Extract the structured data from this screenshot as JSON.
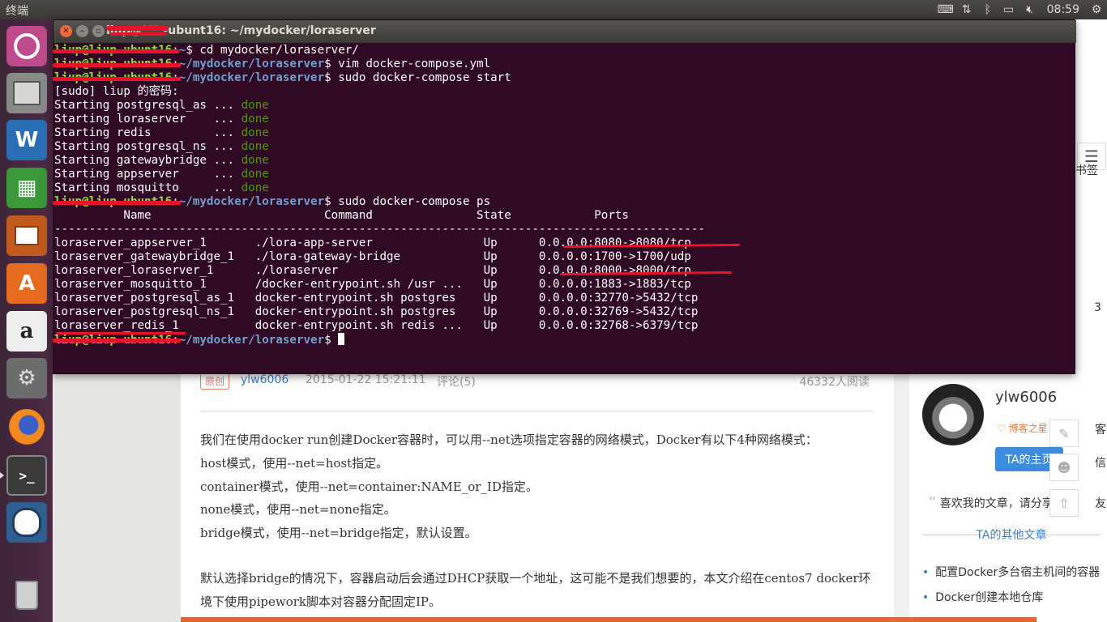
{
  "top_panel": {
    "app_title": "终端",
    "clock": "08:59",
    "tray": [
      "keyboard-icon",
      "network-icon",
      "bluetooth-icon",
      "battery-icon",
      "volume-muted-icon",
      "power-gear-icon"
    ]
  },
  "launcher": {
    "items": [
      "ubuntu-dash-icon",
      "files-icon",
      "libreoffice-writer-icon",
      "libreoffice-calc-icon",
      "libreoffice-impress-icon",
      "software-center-icon",
      "amazon-icon",
      "system-settings-icon",
      "firefox-icon",
      "terminal-icon",
      "postgresql-icon",
      "trash-icon"
    ],
    "amazon_glyph": "a",
    "software_glyph": "A",
    "writer_glyph": "W",
    "calc_glyph": "▦",
    "terminal_glyph": ">_"
  },
  "terminal": {
    "title": "liup@*** -ubunt16: ~/mydocker/loraserver",
    "prompt_dir": "~/mydocker/loraserver",
    "lines": [
      {
        "prompt_host": "liup@liup-ubunt16",
        "sep": ":",
        "dir": "~",
        "cmd": "$ cd mydocker/loraserver/"
      },
      {
        "prompt_host": "liup@liup-ubunt16",
        "sep": ":",
        "dir": "~/mydocker/loraserver",
        "cmd": "$ vim docker-compose.yml"
      },
      {
        "prompt_host": "liup@liup-ubunt16",
        "sep": ":",
        "dir": "~/mydocker/loraserver",
        "cmd": "$ sudo docker-compose start"
      },
      {
        "text": "[sudo] liup 的密码:"
      },
      {
        "text": "Starting postgresql_as ... ",
        "status": "done"
      },
      {
        "text": "Starting loraserver    ... ",
        "status": "done"
      },
      {
        "text": "Starting redis         ... ",
        "status": "done"
      },
      {
        "text": "Starting postgresql_ns ... ",
        "status": "done"
      },
      {
        "text": "Starting gatewaybridge ... ",
        "status": "done"
      },
      {
        "text": "Starting appserver     ... ",
        "status": "done"
      },
      {
        "text": "Starting mosquitto     ... ",
        "status": "done"
      },
      {
        "prompt_host": "liup@liup-ubunt16",
        "sep": ":",
        "dir": "~/mydocker/loraserver",
        "cmd": "$ sudo docker-compose ps"
      },
      {
        "text": "          Name                         Command               State            Ports          "
      },
      {
        "text": "----------------------------------------------------------------------------------------------"
      },
      {
        "text": "loraserver_appserver_1       ./lora-app-server                Up      0.0.0.0:8080->8080/tcp"
      },
      {
        "text": "loraserver_gatewaybridge_1   ./lora-gateway-bridge            Up      0.0.0.0:1700->1700/udp"
      },
      {
        "text": "loraserver_loraserver_1      ./loraserver                     Up      0.0.0.0:8000->8000/tcp"
      },
      {
        "text": "loraserver_mosquitto_1       /docker-entrypoint.sh /usr ...   Up      0.0.0.0:1883->1883/tcp"
      },
      {
        "text": "loraserver_postgresql_as_1   docker-entrypoint.sh postgres    Up      0.0.0.0:32770->5432/tcp"
      },
      {
        "text": "loraserver_postgresql_ns_1   docker-entrypoint.sh postgres    Up      0.0.0.0:32769->5432/tcp"
      },
      {
        "text": "loraserver_redis_1           docker-entrypoint.sh redis ...   Up      0.0.0.0:32768->6379/tcp"
      },
      {
        "prompt_host": "liup@liup-ubunt16",
        "sep": ":",
        "dir": "~/mydocker/loraserver",
        "cmd": "$ "
      }
    ]
  },
  "article": {
    "badge": "原创",
    "author": "ylw6006",
    "date": "2015-01-22 15:21:11",
    "comments": "评论(5)",
    "reads": "46332人阅读",
    "paragraphs": [
      "我们在使用docker run创建Docker容器时，可以用--net选项指定容器的网络模式，Docker有以下4种网络模式：",
      "host模式，使用--net=host指定。",
      "container模式，使用--net=container:NAME_or_ID指定。",
      "none模式，使用--net=none指定。",
      "bridge模式，使用--net=bridge指定，默认设置。",
      "默认选择bridge的情况下，容器启动后会通过DHCP获取一个地址，这可能不是我们想要的，本文介绍在centos7 docker环",
      "境下使用pipework脚本对容器分配固定IP。"
    ]
  },
  "right_column": {
    "name": "ylw6006",
    "rank": "博客之星",
    "home_button": "TA的主页",
    "quote": "喜欢我的文章，请分享",
    "other_heading": "TA的其他文章",
    "links": [
      "配置Docker多台宿主机间的容器",
      "Docker创建本地仓库"
    ],
    "edge_bits": {
      "menu": "☰",
      "bookmark": "书签",
      "num": "3",
      "xin": "信",
      "you": "友",
      "ke": "客"
    }
  },
  "colors": {
    "terminal_bg": "#300a24",
    "prompt_green": "#8ae234",
    "prompt_blue": "#729fcf",
    "done_green": "#4e9a06",
    "redaction_red": "#e8132a",
    "link_blue": "#3c7dc4"
  }
}
